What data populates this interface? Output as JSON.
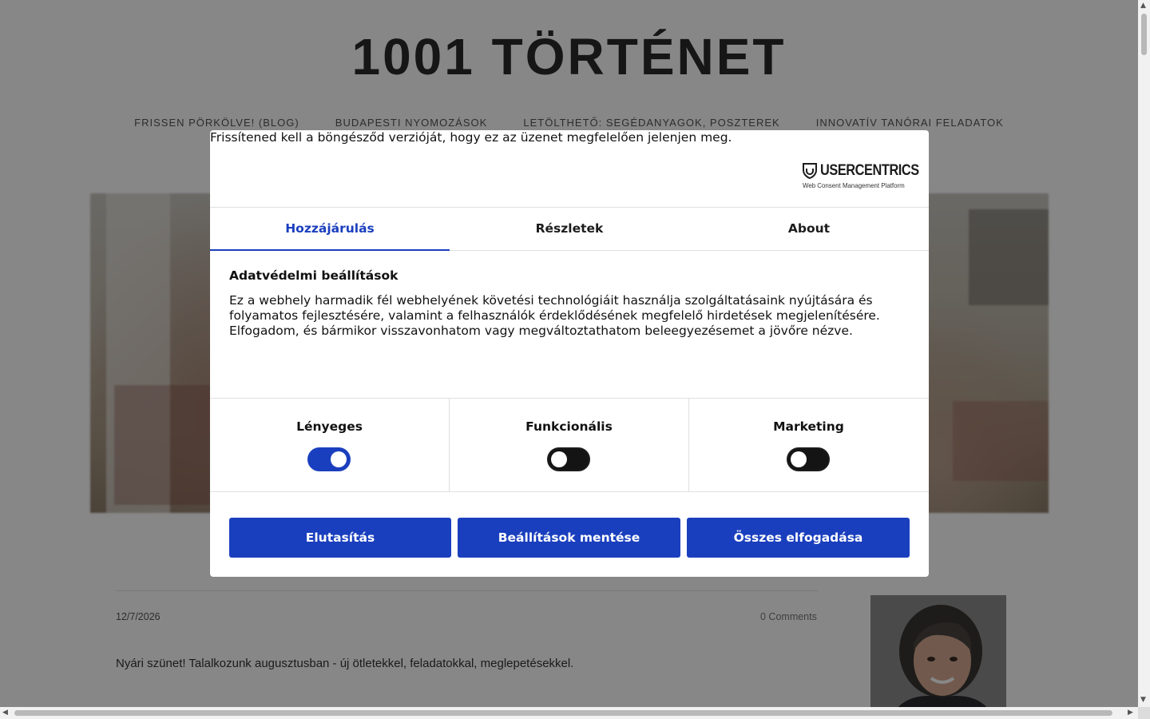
{
  "site": {
    "title": "1001 TÖRTÉNET",
    "nav": [
      "FRISSEN PÖRKÖLVE! (BLOG)",
      "BUDAPESTI NYOMOZÁSOK",
      "LETÖLTHETŐ: SEGÉDANYAGOK, POSZTEREK",
      "INNOVATÍV TANÓRAI FELADATOK"
    ]
  },
  "post": {
    "date": "12/7/2026",
    "comments": "0 Comments",
    "text": "Nyári szünet! Talalkozunk augusztusban - új ötletekkel, feladatokkal, meglepetésekkel."
  },
  "consent": {
    "browser_warning": "Frissítened kell a böngésződ verzióját, hogy ez az üzenet megfelelően jelenjen meg.",
    "logo": {
      "name": "USERCENTRICS",
      "tagline": "Web Consent Management Platform"
    },
    "tabs": [
      "Hozzájárulás",
      "Részletek",
      "About"
    ],
    "active_tab": "Hozzájárulás",
    "title": "Adatvédelmi beállítások",
    "body": "Ez a webhely harmadik fél webhelyének követési technológiáit használja szolgáltatásaink nyújtására és folyamatos fejlesztésére, valamint a felhasználók érdeklődésének megfelelő hirdetések megjelenítésére. Elfogadom, és bármikor visszavonhatom vagy megváltoztathatom beleegyezésemet a jövőre nézve.",
    "toggles": [
      {
        "label": "Lényeges",
        "on": true
      },
      {
        "label": "Funkcionális",
        "on": false
      },
      {
        "label": "Marketing",
        "on": false
      }
    ],
    "buttons": {
      "deny": "Elutasítás",
      "save": "Beállítások mentése",
      "accept_all": "Összes elfogadása"
    },
    "accent_color": "#1a3fbe"
  }
}
